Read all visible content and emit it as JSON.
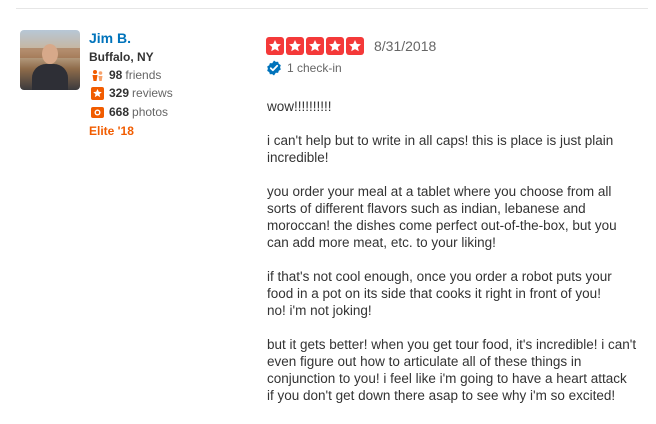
{
  "user": {
    "name": "Jim B.",
    "location": "Buffalo, NY",
    "stats": [
      {
        "icon": "friends-icon",
        "count": "98",
        "label": "friends"
      },
      {
        "icon": "review-star-icon",
        "count": "329",
        "label": "reviews"
      },
      {
        "icon": "camera-icon",
        "count": "668",
        "label": "photos"
      }
    ],
    "elite": "Elite '18"
  },
  "review": {
    "rating": 5,
    "date": "8/31/2018",
    "checkin": "1 check-in",
    "colors": {
      "star": "#f43939",
      "link": "#0073bb",
      "elite": "#f15c00"
    },
    "paragraphs": [
      "wow!!!!!!!!!!",
      "i can't help but to write in all caps!  this is place is just plain incredible!",
      "you order your meal at a tablet where you choose from all sorts of different flavors such as indian, lebanese and moroccan!  the dishes come perfect out-of-the-box, but you can add more meat, etc. to your liking!",
      "if that's not cool enough, once you order a robot puts your food in a pot on its side that cooks it right in front of you!\n no!  i'm not joking!",
      "but it gets better!  when you get tour food, it's incredible!  i can't even figure out how to articulate all of these things in conjunction to you!  i feel like i'm going to have a heart attack if you don't get down there asap to see why i'm so excited!"
    ]
  }
}
